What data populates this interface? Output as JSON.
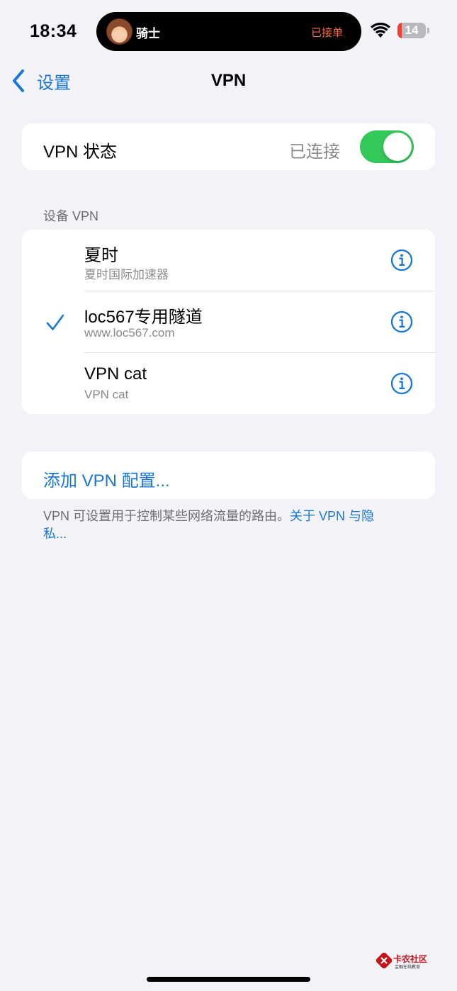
{
  "status_bar": {
    "time": "18:34",
    "island_name": "骑士",
    "island_status": "已接单",
    "battery": "14"
  },
  "nav": {
    "back_label": "设置",
    "title": "VPN"
  },
  "vpn_status": {
    "label": "VPN 状态",
    "value": "已连接",
    "toggle_on": true
  },
  "device_vpn": {
    "header": "设备 VPN",
    "items": [
      {
        "title": "夏时",
        "subtitle": "夏时国际加速器",
        "selected": false
      },
      {
        "title": "loc567专用隧道",
        "subtitle": "www.loc567.com",
        "selected": true
      },
      {
        "title": "VPN cat",
        "subtitle": "VPN cat",
        "selected": false
      }
    ]
  },
  "add_vpn_label": "添加 VPN 配置...",
  "footer": {
    "text": "VPN 可设置用于控制某些网络流量的路由。",
    "link": "关于 VPN 与隐私..."
  },
  "watermark": {
    "title": "卡农社区",
    "subtitle": "金融在线教育"
  },
  "colors": {
    "accent": "#1977d4",
    "toggle_on": "#34c759",
    "background": "#f2f2f7",
    "battery_low": "#ff3b30"
  }
}
